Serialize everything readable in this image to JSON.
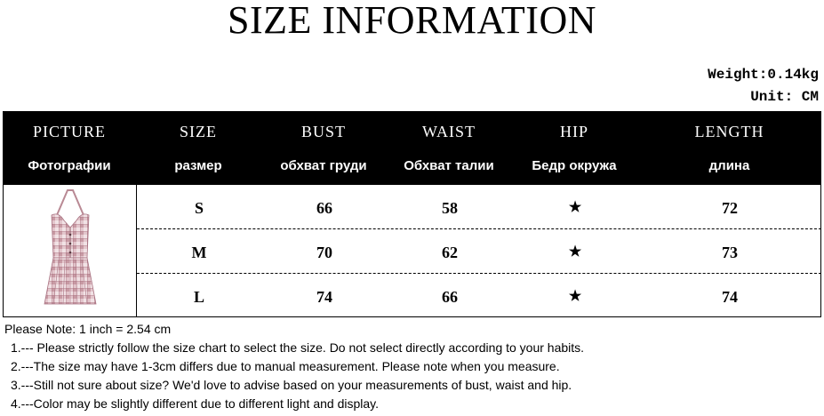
{
  "title": "SIZE INFORMATION",
  "weight": "Weight:0.14kg",
  "unit": "Unit: CM",
  "columns": [
    {
      "en": "PICTURE",
      "ru": "Фотографии"
    },
    {
      "en": "SIZE",
      "ru": "размер"
    },
    {
      "en": "BUST",
      "ru": "обхват груди"
    },
    {
      "en": "WAIST",
      "ru": "Обхват талии"
    },
    {
      "en": "HIP",
      "ru": "Бедр окружа"
    },
    {
      "en": "LENGTH",
      "ru": "длина"
    }
  ],
  "rows": [
    {
      "size": "S",
      "bust": "66",
      "waist": "58",
      "hip": "★",
      "length": "72"
    },
    {
      "size": "M",
      "bust": "70",
      "waist": "62",
      "hip": "★",
      "length": "73"
    },
    {
      "size": "L",
      "bust": "74",
      "waist": "66",
      "hip": "★",
      "length": "74"
    }
  ],
  "notes": {
    "header": "Please Note: 1 inch = 2.54 cm",
    "items": [
      "1.--- Please strictly follow the size chart to select the size. Do not select directly according to your habits.",
      "2.---The size may have 1-3cm differs due to manual measurement. Please note when you measure.",
      "3.---Still not sure about size? We'd love to advise based on your measurements of bust, waist and hip.",
      "4.---Color may be slightly different due to different light and display."
    ]
  },
  "colors": {
    "dress_pink": "#d9b5bd",
    "dress_grid": "#b27e8a",
    "header_bg": "#000000"
  }
}
